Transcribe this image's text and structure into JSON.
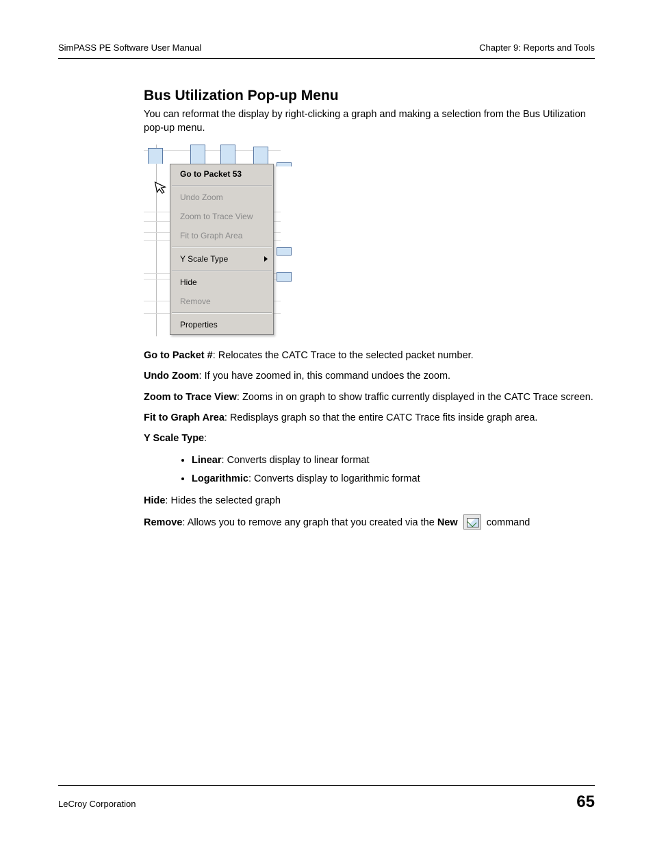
{
  "header": {
    "left": "SimPASS PE Software User Manual",
    "right": "Chapter 9: Reports and Tools"
  },
  "section": {
    "title": "Bus Utilization Pop-up Menu",
    "intro": "You can reformat the display by right-clicking a graph and making a selection from the Bus Utilization pop-up menu."
  },
  "menu": {
    "go_to_packet": "Go to Packet 53",
    "undo_zoom": "Undo Zoom",
    "zoom_trace": "Zoom to Trace View",
    "fit_graph": "Fit to Graph Area",
    "yscale": "Y Scale Type",
    "hide": "Hide",
    "remove": "Remove",
    "properties": "Properties"
  },
  "defs": {
    "goto_label": "Go to Packet #",
    "goto_text": ": Relocates the CATC Trace to the selected packet number.",
    "undo_label": "Undo Zoom",
    "undo_text": ": If you have zoomed in, this command undoes the zoom.",
    "zoom_label": "Zoom to Trace View",
    "zoom_text": ": Zooms in on graph to show traffic currently displayed in the CATC Trace screen.",
    "fit_label": "Fit to Graph Area",
    "fit_text": ": Redisplays graph so that the entire CATC Trace fits inside graph area.",
    "yscale_label": "Y Scale Type",
    "yscale_colon": ":",
    "linear_label": "Linear",
    "linear_text": ": Converts display to linear format",
    "log_label": "Logarithmic",
    "log_text": ": Converts display to logarithmic format",
    "hide_label": "Hide",
    "hide_text": ": Hides the selected graph",
    "remove_label": "Remove",
    "remove_text_pre": ": Allows you to remove any graph that you created via the ",
    "remove_new": "New",
    "remove_text_post": " command"
  },
  "footer": {
    "left": "LeCroy Corporation",
    "page": "65"
  }
}
